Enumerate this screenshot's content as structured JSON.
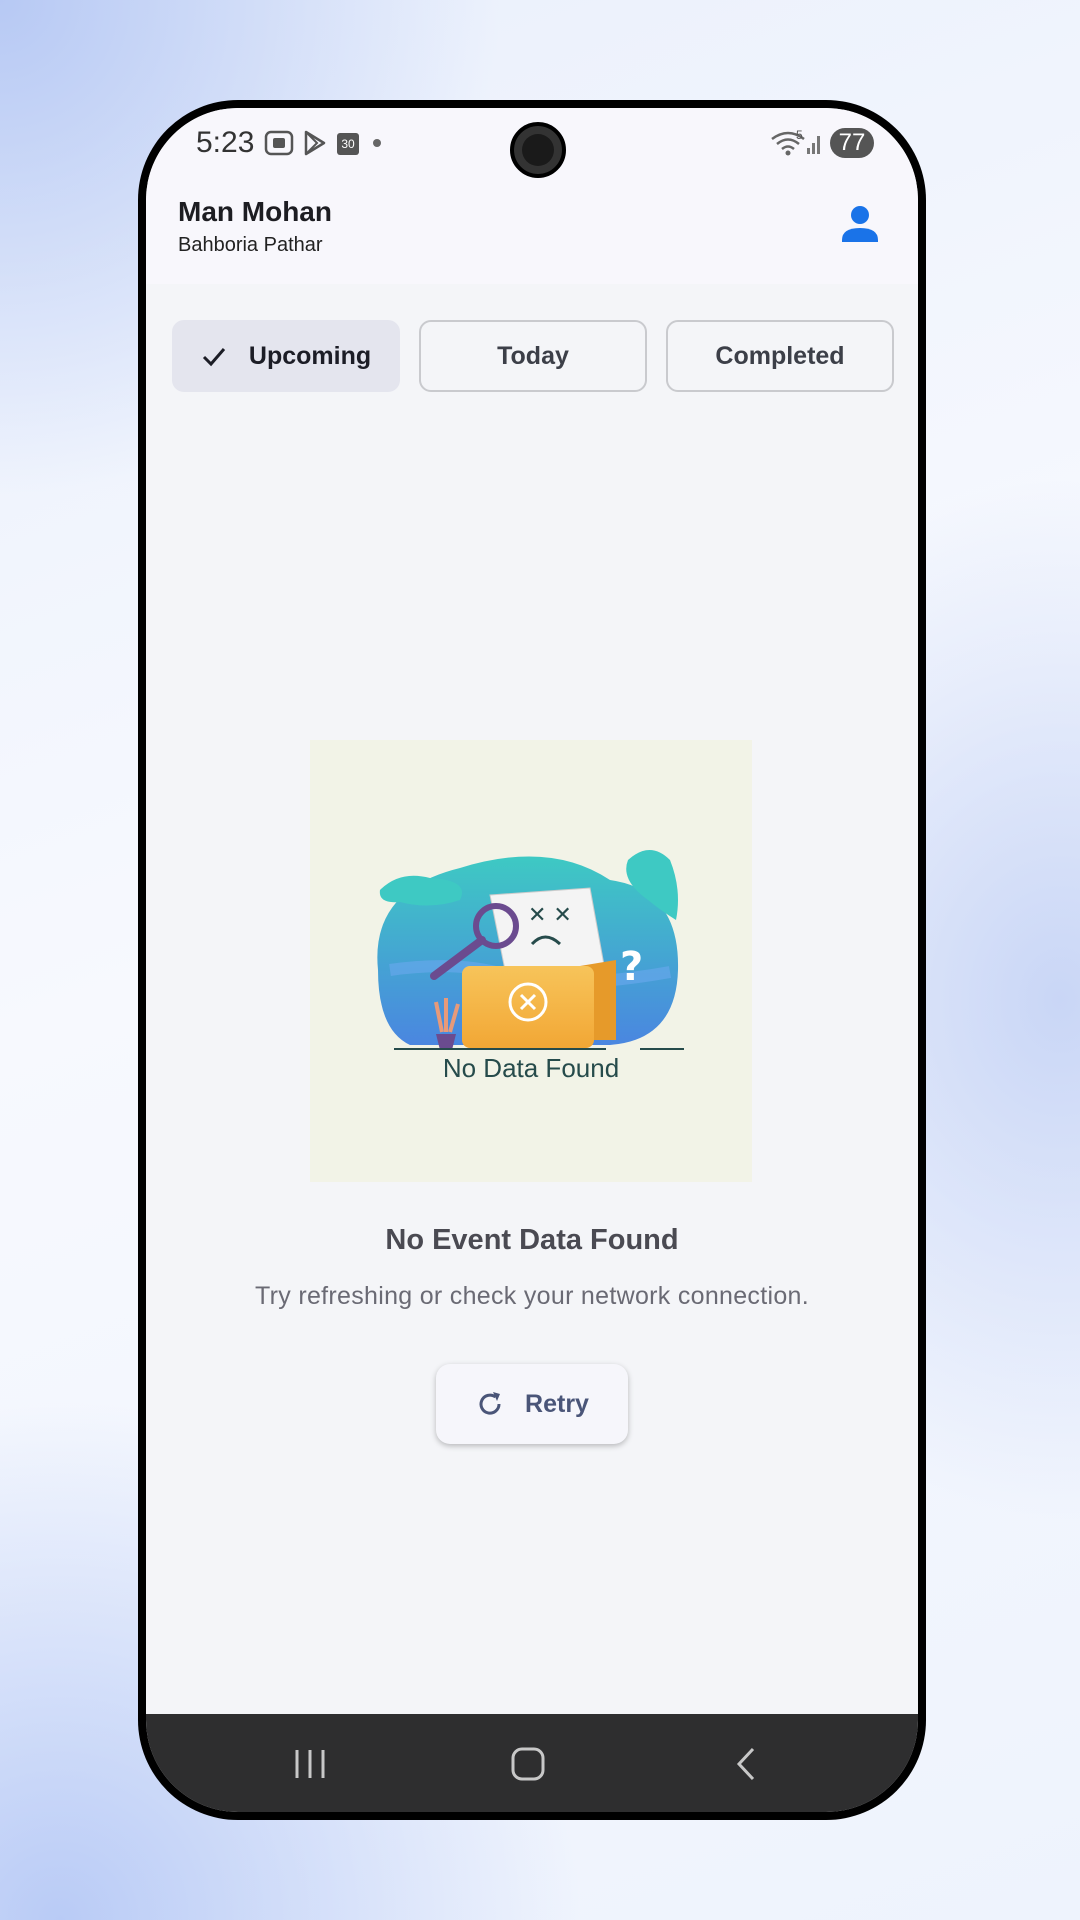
{
  "status_bar": {
    "time": "5:23",
    "notification_icons": [
      "screenshot-icon",
      "play-store-icon",
      "calendar-icon",
      "dot-icon"
    ],
    "calendar_day": "30",
    "network_label": "5",
    "battery": "77"
  },
  "header": {
    "name": "Man Mohan",
    "location": "Bahboria Pathar",
    "profile_icon": "person-icon"
  },
  "tabs": [
    {
      "label": "Upcoming",
      "selected": true
    },
    {
      "label": "Today",
      "selected": false
    },
    {
      "label": "Completed",
      "selected": false
    }
  ],
  "empty_state": {
    "illustration_caption": "No Data Found",
    "title": "No Event Data Found",
    "message": "Try refreshing or check your network connection.",
    "retry_label": "Retry"
  },
  "nav_bar": {
    "items": [
      "recents-icon",
      "home-icon",
      "back-icon"
    ]
  },
  "colors": {
    "accent": "#1a73e8",
    "tab_selected_bg": "#e4e5ee",
    "screen_bg": "#f4f5f8",
    "nav_bar_bg": "#2e2e2f"
  }
}
